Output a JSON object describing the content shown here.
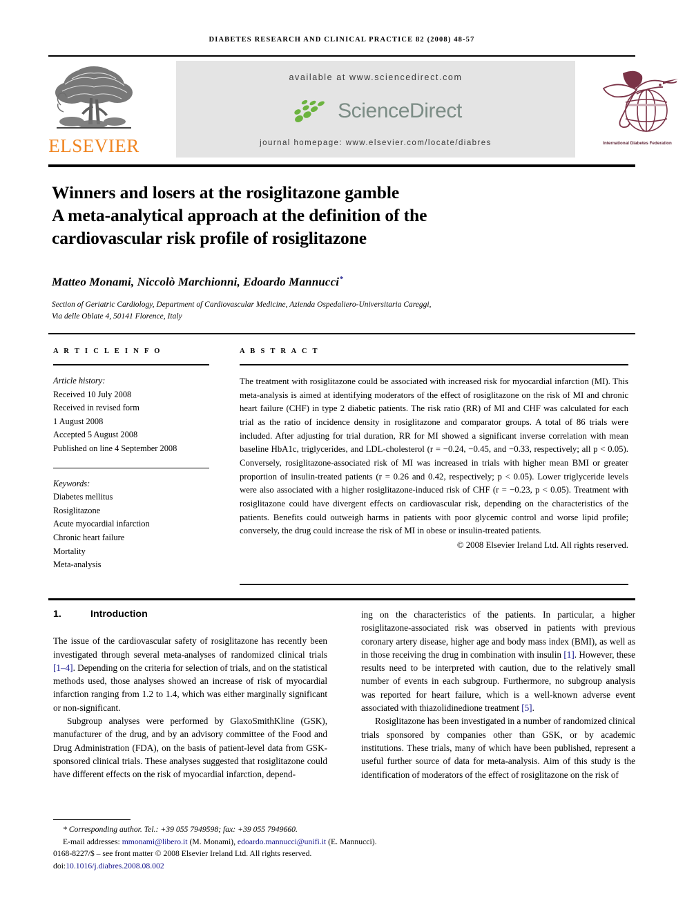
{
  "running_head": "DIABETES RESEARCH AND CLINICAL PRACTICE 82 (2008) 48-57",
  "masthead": {
    "publisher_name": "ELSEVIER",
    "available_at": "available at www.sciencedirect.com",
    "sciencedirect_name": "ScienceDirect",
    "journal_homepage": "journal homepage: www.elsevier.com/locate/diabres",
    "idf_caption": "International Diabetes Federation",
    "colors": {
      "elsevier_orange": "#F08521",
      "sciencedirect_gray": "#7b8c85",
      "sciencedirect_green": "#6cb33f",
      "idf_maroon": "#7a3347",
      "banner_gray": "#e4e4e4",
      "link_blue": "#14148c"
    }
  },
  "title": {
    "line1": "Winners and losers at the rosiglitazone gamble",
    "line2": "A meta-analytical approach at the definition of the",
    "line3": "cardiovascular risk profile of rosiglitazone"
  },
  "authors": {
    "names": "Matteo Monami, Niccolò Marchionni, Edoardo Mannucci",
    "corresponding_marker": "*",
    "affiliation_line1": "Section of Geriatric Cardiology, Department of Cardiovascular Medicine, Azienda Ospedaliero-Universitaria Careggi,",
    "affiliation_line2": "Via delle Oblate 4, 50141 Florence, Italy"
  },
  "article_info": {
    "heading": "A R T I C L E  I N F O",
    "history_label": "Article history:",
    "history": [
      "Received 10 July 2008",
      "Received in revised form",
      "1 August 2008",
      "Accepted 5 August 2008",
      "Published on line 4 September 2008"
    ],
    "keywords_label": "Keywords:",
    "keywords": [
      "Diabetes mellitus",
      "Rosiglitazone",
      "Acute myocardial infarction",
      "Chronic heart failure",
      "Mortality",
      "Meta-analysis"
    ]
  },
  "abstract": {
    "heading": "A B S T R A C T",
    "body": "The treatment with rosiglitazone could be associated with increased risk for myocardial infarction (MI). This meta-analysis is aimed at identifying moderators of the effect of rosiglitazone on the risk of MI and chronic heart failure (CHF) in type 2 diabetic patients. The risk ratio (RR) of MI and CHF was calculated for each trial as the ratio of incidence density in rosiglitazone and comparator groups. A total of 86 trials were included. After adjusting for trial duration, RR for MI showed a significant inverse correlation with mean baseline HbA1c, triglycerides, and LDL-cholesterol (r = −0.24, −0.45, and −0.33, respectively; all p < 0.05). Conversely, rosiglitazone-associated risk of MI was increased in trials with higher mean BMI or greater proportion of insulin-treated patients (r = 0.26 and 0.42, respectively; p < 0.05). Lower triglyceride levels were also associated with a higher rosiglitazone-induced risk of CHF (r = −0.23, p < 0.05). Treatment with rosiglitazone could have divergent effects on cardiovascular risk, depending on the characteristics of the patients. Benefits could outweigh harms in patients with poor glycemic control and worse lipid profile; conversely, the drug could increase the risk of MI in obese or insulin-treated patients.",
    "copyright": "© 2008 Elsevier Ireland Ltd. All rights reserved."
  },
  "introduction": {
    "number": "1.",
    "heading": "Introduction",
    "left_para1_a": "The issue of the cardiovascular safety of rosiglitazone has recently been investigated through several meta-analyses of randomized clinical trials ",
    "left_para1_ref": "[1–4]",
    "left_para1_b": ". Depending on the criteria for selection of trials, and on the statistical methods used, those analyses showed an increase of risk of myocardial infarction ranging from 1.2 to 1.4, which was either marginally significant or non-significant.",
    "left_para2": "Subgroup analyses were performed by GlaxoSmithKline (GSK), manufacturer of the drug, and by an advisory committee of the Food and Drug Administration (FDA), on the basis of patient-level data from GSK-sponsored clinical trials. These analyses suggested that rosiglitazone could have different effects on the risk of myocardial infarction, depend-",
    "right_para1_a": "ing on the characteristics of the patients. In particular, a higher rosiglitazone-associated risk was observed in patients with previous coronary artery disease, higher age and body mass index (BMI), as well as in those receiving the drug in combination with insulin ",
    "right_para1_ref": "[1]",
    "right_para1_b": ". However, these results need to be interpreted with caution, due to the relatively small number of events in each subgroup. Furthermore, no subgroup analysis was reported for heart failure, which is a well-known adverse event associated with thiazolidinedione treatment ",
    "right_para1_ref2": "[5]",
    "right_para1_c": ".",
    "right_para2": "Rosiglitazone has been investigated in a number of randomized clinical trials sponsored by companies other than GSK, or by academic institutions. These trials, many of which have been published, represent a useful further source of data for meta-analysis. Aim of this study is the identification of moderators of the effect of rosiglitazone on the risk of"
  },
  "footer": {
    "corresponding_marker": "*",
    "corresponding": "Corresponding author. Tel.: +39 055 7949598; fax: +39 055 7949660.",
    "email_label": "E-mail addresses:",
    "email1": "mmonami@libero.it",
    "email1_owner": "(M. Monami),",
    "email2": "edoardo.mannucci@unifi.it",
    "email2_owner": "(E. Mannucci).",
    "frontmatter": "0168-8227/$ – see front matter © 2008 Elsevier Ireland Ltd. All rights reserved.",
    "doi_label": "doi:",
    "doi": "10.1016/j.diabres.2008.08.002"
  }
}
